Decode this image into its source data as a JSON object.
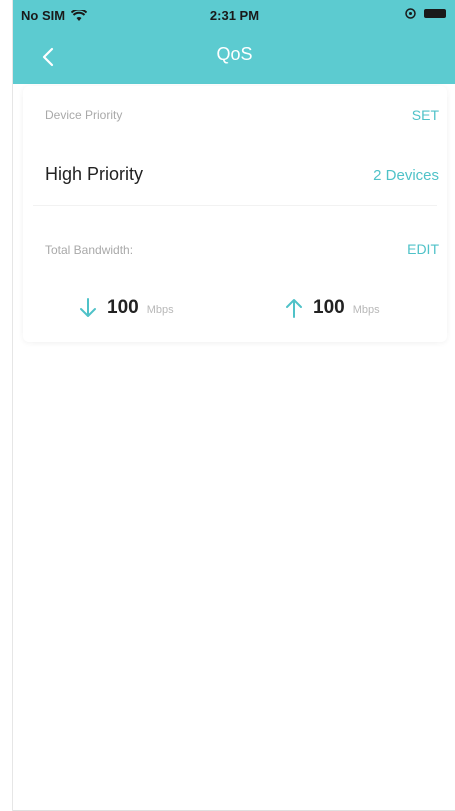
{
  "status_bar": {
    "carrier": "No SIM",
    "time": "2:31 PM"
  },
  "nav": {
    "title": "QoS"
  },
  "device_priority": {
    "label": "Device Priority",
    "action": "SET",
    "priority_name": "High Priority",
    "device_count": "2 Devices"
  },
  "bandwidth": {
    "label": "Total Bandwidth:",
    "action": "EDIT",
    "download_value": "100",
    "download_unit": "Mbps",
    "upload_value": "100",
    "upload_unit": "Mbps"
  },
  "colors": {
    "accent": "#5ccbd0",
    "link": "#4fc2c8"
  },
  "icons": {
    "back": "chevron-left-icon",
    "wifi": "wifi-icon",
    "download": "arrow-down-icon",
    "upload": "arrow-up-icon"
  }
}
